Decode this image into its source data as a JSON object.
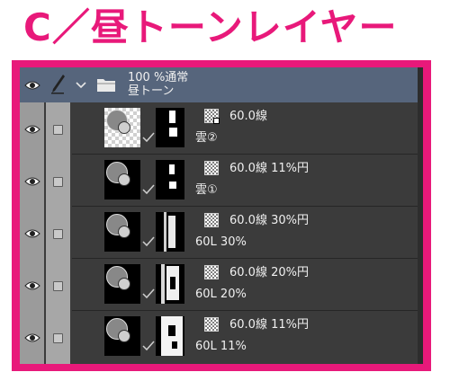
{
  "title": "C／昼トーンレイヤー",
  "colors": {
    "accent": "#e8197a",
    "panel_bg": "#3b3b3b",
    "folder_bg": "#56657c"
  },
  "folder": {
    "opacity_blend": "100 %通常",
    "name": "昼トーン",
    "icon": "folder-icon"
  },
  "layers": [
    {
      "props": "60.0線",
      "name": "雲②"
    },
    {
      "props": "60.0線 11%円",
      "name": "雲①"
    },
    {
      "props": "60.0線 30%円",
      "name": "60L 30%"
    },
    {
      "props": "60.0線 20%円",
      "name": "60L 20%"
    },
    {
      "props": "60.0線 11%円",
      "name": "60L 11%"
    }
  ]
}
